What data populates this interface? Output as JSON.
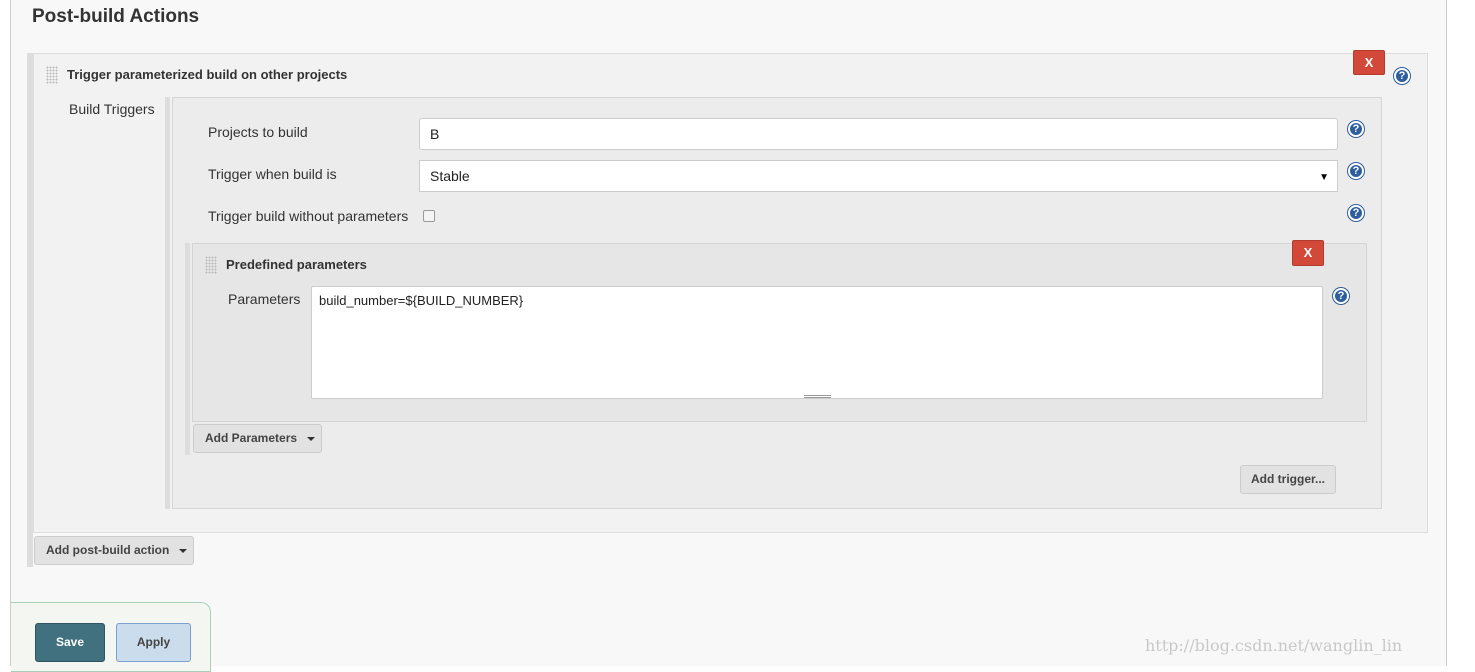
{
  "section_title": "Post-build Actions",
  "action": {
    "title": "Trigger parameterized build on other projects",
    "delete_label": "X",
    "build_triggers_label": "Build Triggers",
    "projects_label": "Projects to build",
    "projects_value": "B",
    "trigger_when_label": "Trigger when build is",
    "trigger_when_value": "Stable",
    "no_params_label": "Trigger build without parameters",
    "no_params_checked": false,
    "predefined": {
      "title": "Predefined parameters",
      "delete_label": "X",
      "parameters_label": "Parameters",
      "parameters_value": "build_number=${BUILD_NUMBER}"
    },
    "add_parameters_label": "Add Parameters",
    "add_trigger_label": "Add trigger..."
  },
  "add_post_build_label": "Add post-build action",
  "footer": {
    "save_label": "Save",
    "apply_label": "Apply"
  },
  "watermark": "http://blog.csdn.net/wanglin_lin",
  "colors": {
    "delete": "#d24939",
    "save": "#41707f",
    "apply": "#cbdded",
    "help": "#2e5e9e"
  }
}
